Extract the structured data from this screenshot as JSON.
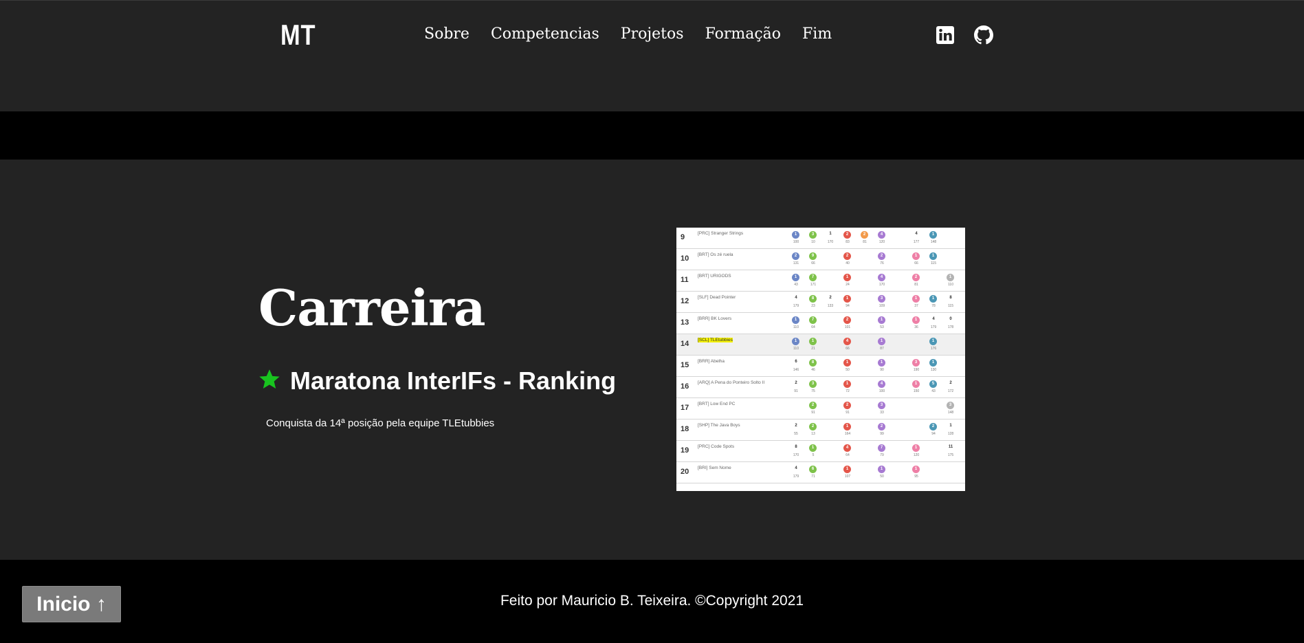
{
  "header": {
    "logo": "MT",
    "nav": [
      {
        "label": "Sobre"
      },
      {
        "label": "Competencias"
      },
      {
        "label": "Projetos"
      },
      {
        "label": "Formação"
      },
      {
        "label": "Fim"
      }
    ],
    "social": [
      "linkedin-icon",
      "github-icon"
    ]
  },
  "main": {
    "title": "Carreira",
    "subtitle": "Maratona InterIFs - Ranking",
    "star_color": "#18c31f",
    "description": "Conquista da 14ª posição pela equipe TLEtubbies"
  },
  "ranking": {
    "highlight_team": "[SCL] TLEtubbies",
    "rows": [
      {
        "pos": "9",
        "team": "[PRC] Stranger Strings",
        "cells": [
          [
            "b",
            "1",
            "100"
          ],
          [
            "g",
            "3",
            "10"
          ],
          [
            "p",
            "1",
            "170"
          ],
          [
            "r",
            "2",
            "83"
          ],
          [
            "o",
            "2",
            "81"
          ],
          [
            "v",
            "4",
            "120"
          ],
          [
            "n",
            "",
            ""
          ],
          [
            "p",
            "4",
            "177"
          ],
          [
            "t",
            "1",
            "148"
          ],
          [
            "n",
            "",
            ""
          ]
        ]
      },
      {
        "pos": "10",
        "team": "[BRT] Os zé ruela",
        "cells": [
          [
            "b",
            "2",
            "131"
          ],
          [
            "g",
            "9",
            "66"
          ],
          [
            "n",
            "",
            ""
          ],
          [
            "r",
            "2",
            "40"
          ],
          [
            "n",
            "",
            ""
          ],
          [
            "v",
            "2",
            "76"
          ],
          [
            "n",
            "",
            ""
          ],
          [
            "k",
            "1",
            "66"
          ],
          [
            "t",
            "1",
            "115"
          ],
          [
            "n",
            "",
            ""
          ]
        ]
      },
      {
        "pos": "11",
        "team": "[BRT] URIGODS",
        "cells": [
          [
            "b",
            "1",
            "43"
          ],
          [
            "g",
            "7",
            "171"
          ],
          [
            "n",
            "",
            ""
          ],
          [
            "r",
            "1",
            "24"
          ],
          [
            "n",
            "",
            ""
          ],
          [
            "v",
            "4",
            "170"
          ],
          [
            "n",
            "",
            ""
          ],
          [
            "k",
            "2",
            "81"
          ],
          [
            "n",
            "",
            ""
          ],
          [
            "s",
            "1",
            "110"
          ]
        ]
      },
      {
        "pos": "12",
        "team": "[SLF] Dead Pointer",
        "cells": [
          [
            "p",
            "4",
            "179"
          ],
          [
            "g",
            "8",
            "23"
          ],
          [
            "p",
            "2",
            "133"
          ],
          [
            "r",
            "1",
            "94"
          ],
          [
            "n",
            "",
            ""
          ],
          [
            "v",
            "3",
            "109"
          ],
          [
            "n",
            "",
            ""
          ],
          [
            "k",
            "1",
            "37"
          ],
          [
            "t",
            "1",
            "78"
          ],
          [
            "p",
            "8",
            "115"
          ]
        ]
      },
      {
        "pos": "13",
        "team": "[BRR] BK Lovers",
        "cells": [
          [
            "b",
            "1",
            "110"
          ],
          [
            "g",
            "7",
            "64"
          ],
          [
            "n",
            "",
            ""
          ],
          [
            "r",
            "2",
            "101"
          ],
          [
            "n",
            "",
            ""
          ],
          [
            "v",
            "1",
            "53"
          ],
          [
            "n",
            "",
            ""
          ],
          [
            "k",
            "1",
            "36"
          ],
          [
            "p",
            "4",
            "179"
          ],
          [
            "p",
            "0",
            "178"
          ]
        ]
      },
      {
        "pos": "14",
        "team": "[SCL] TLEtubbies",
        "cells": [
          [
            "b",
            "1",
            "110"
          ],
          [
            "g",
            "1",
            "21"
          ],
          [
            "n",
            "",
            ""
          ],
          [
            "r",
            "4",
            "66"
          ],
          [
            "n",
            "",
            ""
          ],
          [
            "v",
            "1",
            "87"
          ],
          [
            "n",
            "",
            ""
          ],
          [
            "n",
            "",
            ""
          ],
          [
            "t",
            "1",
            "176"
          ],
          [
            "n",
            "",
            ""
          ]
        ]
      },
      {
        "pos": "15",
        "team": "[BRR] Abelha",
        "cells": [
          [
            "p",
            "6",
            "146"
          ],
          [
            "g",
            "8",
            "46"
          ],
          [
            "n",
            "",
            ""
          ],
          [
            "r",
            "1",
            "50"
          ],
          [
            "n",
            "",
            ""
          ],
          [
            "v",
            "1",
            "90"
          ],
          [
            "n",
            "",
            ""
          ],
          [
            "k",
            "3",
            "190"
          ],
          [
            "t",
            "1",
            "130"
          ],
          [
            "n",
            "",
            ""
          ]
        ]
      },
      {
        "pos": "16",
        "team": "[ARQ] A Pena do Ponteiro Solto II",
        "cells": [
          [
            "p",
            "2",
            "91"
          ],
          [
            "g",
            "3",
            "75"
          ],
          [
            "n",
            "",
            ""
          ],
          [
            "r",
            "1",
            "72"
          ],
          [
            "n",
            "",
            ""
          ],
          [
            "v",
            "4",
            "100"
          ],
          [
            "n",
            "",
            ""
          ],
          [
            "k",
            "1",
            "150"
          ],
          [
            "t",
            "5",
            "43"
          ],
          [
            "p",
            "2",
            "172"
          ]
        ]
      },
      {
        "pos": "17",
        "team": "[BRT] Low End PC",
        "cells": [
          [
            "n",
            "",
            ""
          ],
          [
            "g",
            "2",
            "91"
          ],
          [
            "n",
            "",
            ""
          ],
          [
            "r",
            "2",
            "91"
          ],
          [
            "n",
            "",
            ""
          ],
          [
            "v",
            "3",
            "33"
          ],
          [
            "n",
            "",
            ""
          ],
          [
            "n",
            "",
            ""
          ],
          [
            "n",
            "",
            ""
          ],
          [
            "s",
            "3",
            "148"
          ]
        ]
      },
      {
        "pos": "18",
        "team": "[SHP] The Java Boys",
        "cells": [
          [
            "p",
            "2",
            "55"
          ],
          [
            "g",
            "2",
            "13"
          ],
          [
            "n",
            "",
            ""
          ],
          [
            "r",
            "1",
            "164"
          ],
          [
            "n",
            "",
            ""
          ],
          [
            "v",
            "2",
            "99"
          ],
          [
            "n",
            "",
            ""
          ],
          [
            "n",
            "",
            ""
          ],
          [
            "t",
            "2",
            "94"
          ],
          [
            "p",
            "1",
            "128"
          ]
        ]
      },
      {
        "pos": "19",
        "team": "[PRC] Code Spots",
        "cells": [
          [
            "p",
            "8",
            "170"
          ],
          [
            "g",
            "1",
            "5"
          ],
          [
            "n",
            "",
            ""
          ],
          [
            "r",
            "4",
            "64"
          ],
          [
            "n",
            "",
            ""
          ],
          [
            "v",
            "7",
            "79"
          ],
          [
            "n",
            "",
            ""
          ],
          [
            "k",
            "1",
            "120"
          ],
          [
            "n",
            "",
            ""
          ],
          [
            "p",
            "11",
            "175"
          ]
        ]
      },
      {
        "pos": "20",
        "team": "[BRI] Sem Nome",
        "cells": [
          [
            "p",
            "4",
            "179"
          ],
          [
            "g",
            "6",
            "71"
          ],
          [
            "n",
            "",
            ""
          ],
          [
            "r",
            "1",
            "107"
          ],
          [
            "n",
            "",
            ""
          ],
          [
            "v",
            "1",
            "50"
          ],
          [
            "n",
            "",
            ""
          ],
          [
            "k",
            "1",
            "95"
          ],
          [
            "n",
            "",
            ""
          ],
          [
            "n",
            "",
            ""
          ]
        ]
      }
    ]
  },
  "footer": {
    "credit": "Feito por Mauricio B. Teixeira. ©Copyright 2021",
    "back_label": "Inicio ↑"
  }
}
